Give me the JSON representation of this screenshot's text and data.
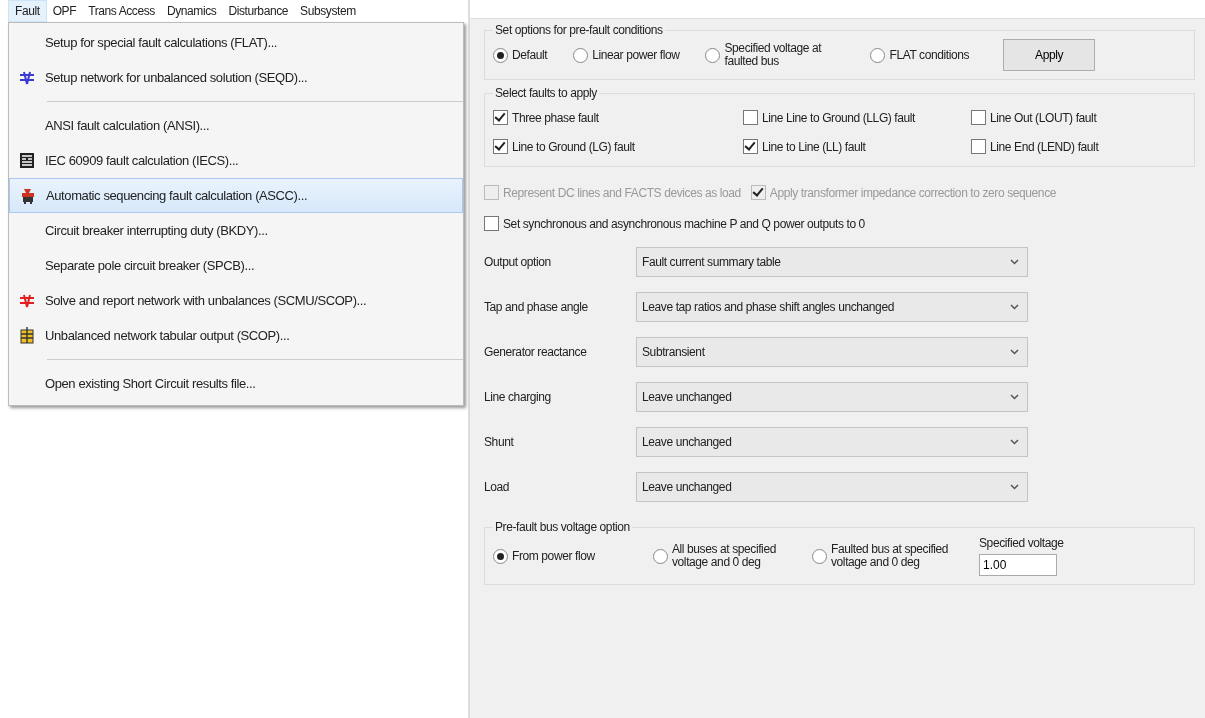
{
  "menubar": [
    {
      "label": "Fault",
      "selected": true
    },
    {
      "label": "OPF",
      "selected": false
    },
    {
      "label": "Trans Access",
      "selected": false
    },
    {
      "label": "Dynamics",
      "selected": false
    },
    {
      "label": "Disturbance",
      "selected": false
    },
    {
      "label": "Subsystem",
      "selected": false
    }
  ],
  "menu": {
    "items": [
      {
        "kind": "item",
        "label": "Setup for special fault calculations (FLAT)...",
        "selected": false
      },
      {
        "kind": "item",
        "label": "Setup network for unbalanced solution (SEQD)...",
        "selected": false
      },
      {
        "kind": "separator"
      },
      {
        "kind": "item",
        "label": "ANSI fault calculation (ANSI)...",
        "selected": false
      },
      {
        "kind": "item",
        "label": "IEC 60909 fault calculation (IECS)...",
        "selected": false
      },
      {
        "kind": "item",
        "label": "Automatic sequencing fault calculation (ASCC)...",
        "selected": true
      },
      {
        "kind": "item",
        "label": "Circuit breaker interrupting duty (BKDY)...",
        "selected": false
      },
      {
        "kind": "item",
        "label": "Separate pole circuit breaker (SPCB)...",
        "selected": false
      },
      {
        "kind": "item",
        "label": "Solve and report network with unbalances (SCMU/SCOP)...",
        "selected": false
      },
      {
        "kind": "item",
        "label": "Unbalanced network tabular output (SCOP)...",
        "selected": false
      },
      {
        "kind": "separator"
      },
      {
        "kind": "item",
        "label": "Open existing Short Circuit results file...",
        "selected": false
      }
    ]
  },
  "dialog": {
    "prefault": {
      "title": "Set options for pre-fault conditions",
      "options": [
        {
          "label": "Default",
          "selected": true
        },
        {
          "label": "Linear power flow",
          "selected": false
        },
        {
          "label": "Specified voltage at faulted bus",
          "selected": false
        },
        {
          "label": "FLAT conditions",
          "selected": false
        }
      ],
      "apply": "Apply"
    },
    "faults": {
      "title": "Select faults to apply",
      "options": [
        {
          "label": "Three phase fault",
          "checked": true
        },
        {
          "label": "Line Line to Ground (LLG) fault",
          "checked": false
        },
        {
          "label": "Line Out (LOUT) fault",
          "checked": false
        },
        {
          "label": "Line to Ground (LG) fault",
          "checked": true
        },
        {
          "label": "Line to Line (LL) fault",
          "checked": true
        },
        {
          "label": "Line End (LEND) fault",
          "checked": false
        }
      ]
    },
    "options_row": [
      {
        "label": "Represent DC lines and FACTS devices as load",
        "checked": false,
        "disabled": true
      },
      {
        "label": "Apply transformer impedance correction to zero sequence",
        "checked": true,
        "disabled": true
      }
    ],
    "machine_option": {
      "label": "Set synchronous and asynchronous machine P and Q power outputs to 0",
      "checked": false,
      "disabled": false
    },
    "dropdowns": [
      {
        "label": "Output option",
        "value": "Fault current summary table"
      },
      {
        "label": "Tap and phase angle",
        "value": "Leave tap ratios and phase shift angles unchanged"
      },
      {
        "label": "Generator reactance",
        "value": "Subtransient"
      },
      {
        "label": "Line charging",
        "value": "Leave unchanged"
      },
      {
        "label": "Shunt",
        "value": "Leave unchanged"
      },
      {
        "label": "Load",
        "value": "Leave unchanged"
      }
    ],
    "bus_voltage": {
      "title": "Pre-fault bus voltage option",
      "options": [
        {
          "label": "From power flow",
          "selected": true
        },
        {
          "label": "All buses at specified voltage and 0 deg",
          "selected": false
        },
        {
          "label": "Faulted bus at specified voltage and 0 deg",
          "selected": false
        }
      ],
      "specified_label": "Specified voltage",
      "specified_value": "1.00"
    }
  }
}
